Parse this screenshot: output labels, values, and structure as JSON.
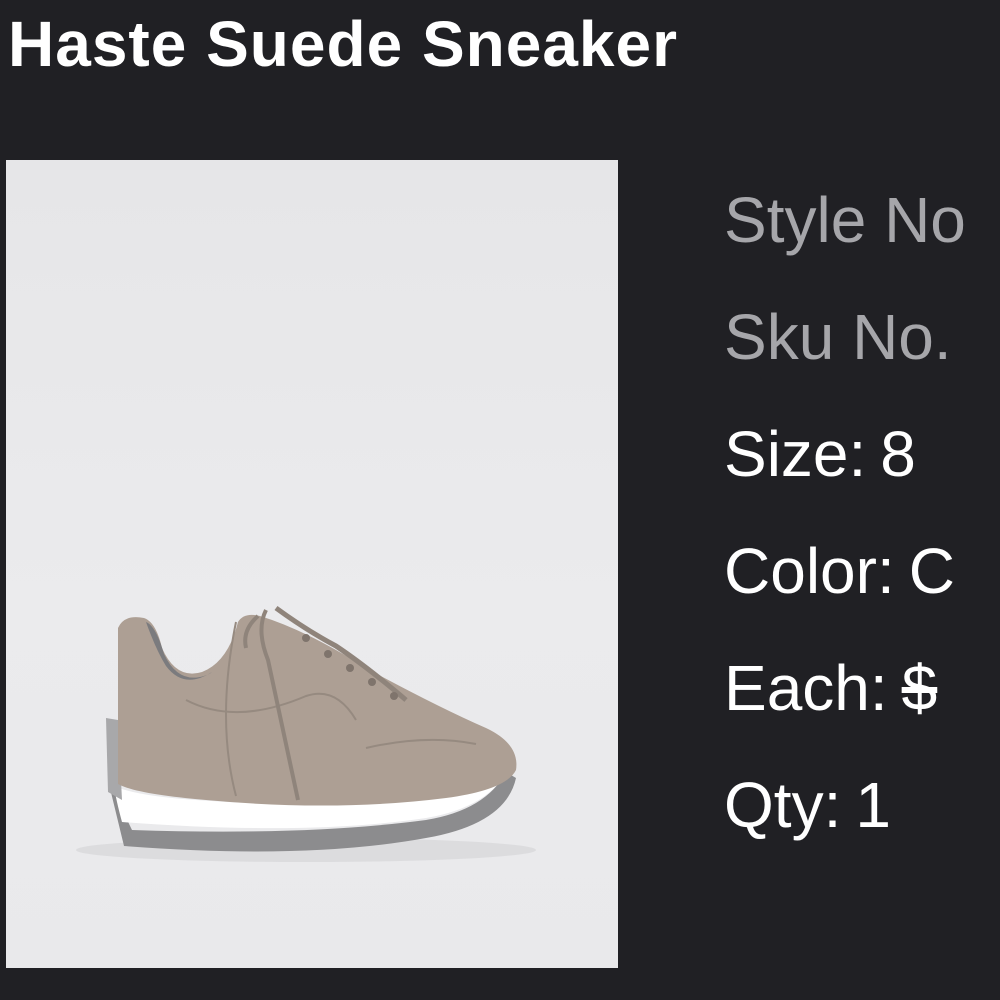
{
  "product": {
    "title": "Haste Suede Sneaker",
    "image": {
      "icon": "sneaker-product-photo",
      "background_color": "#e8e8ea",
      "shoe_color": "#ad9f94",
      "sole_color": "#ffffff",
      "outsole_color": "#8c8c8e"
    }
  },
  "details": {
    "style": {
      "label": "Style No",
      "value": ""
    },
    "sku": {
      "label": "Sku No.",
      "value": ""
    },
    "size": {
      "label": "Size:",
      "value": "8"
    },
    "color": {
      "label": "Color:",
      "value": "C"
    },
    "each": {
      "label": "Each:",
      "value": "$"
    },
    "qty": {
      "label": "Qty:",
      "value": "1"
    }
  }
}
